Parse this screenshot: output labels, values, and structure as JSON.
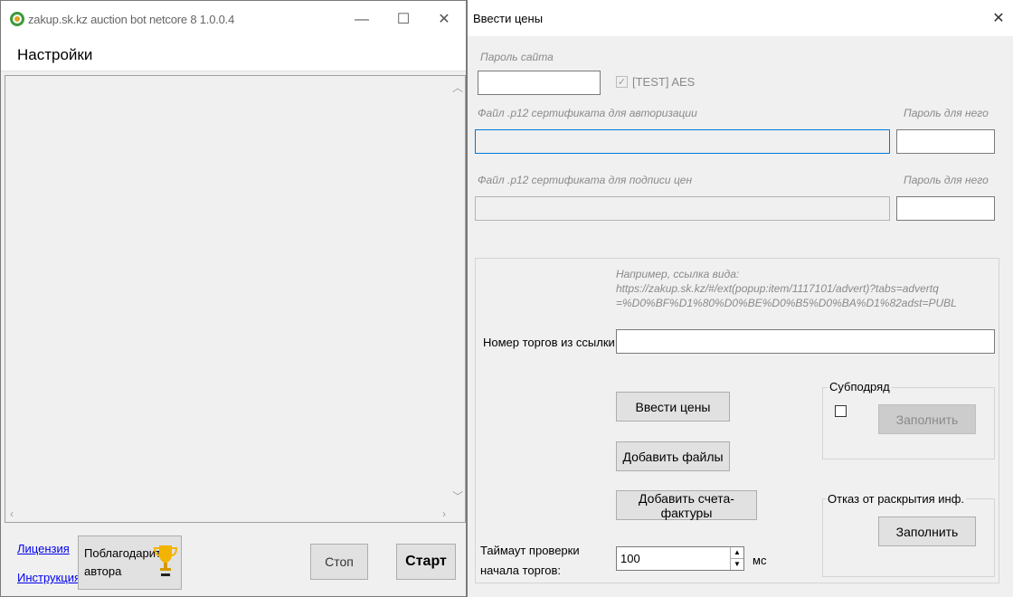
{
  "main_window": {
    "title": "zakup.sk.kz auction bot netcore 8 1.0.0.4",
    "controls": {
      "minimize": "—",
      "maximize": "☐",
      "close": "✕"
    },
    "menu": {
      "settings": "Настройки"
    },
    "links": {
      "license": "Лицензия",
      "instruction": "Инструкция"
    },
    "buttons": {
      "thank_line1": "Поблагодарить",
      "thank_line2": "автора",
      "stop": "Стоп",
      "start": "Старт"
    }
  },
  "dialog": {
    "title": "Ввести цены",
    "close": "✕",
    "site_password_label": "Пароль сайта",
    "site_password_value": "",
    "aes_checkbox_label": "[TEST] AES",
    "aes_checked": true,
    "auth_cert_label": "Файл .p12 сертификата для авторизации",
    "auth_cert_value": "",
    "auth_cert_password_label": "Пароль для него",
    "sign_cert_label": "Файл .p12 сертификата для подписи цен",
    "sign_cert_value": "",
    "sign_cert_password_label": "Пароль для него",
    "example_lines": [
      "Например, ссылка вида:",
      "https://zakup.sk.kz/#/ext(popup:item/1117101/advert)?tabs=advertq",
      "=%D0%BF%D1%80%D0%BE%D0%B5%D0%BA%D1%82adst=PUBL"
    ],
    "tender_number_label": "Номер торгов из ссылки:",
    "tender_number_value": "",
    "buttons": {
      "enter_prices": "Ввести цены",
      "add_files": "Добавить файлы",
      "add_invoices": "Добавить счета-фактуры"
    },
    "subcontract_group": {
      "title": "Субподряд",
      "fill_button": "Заполнить",
      "checked": false
    },
    "disclosure_group": {
      "title": "Отказ от раскрытия инф.",
      "fill_button": "Заполнить"
    },
    "timeout_label_line1": "Таймаут проверки",
    "timeout_label_line2": "начала торгов:",
    "timeout_value": "100",
    "timeout_unit": "мс"
  }
}
